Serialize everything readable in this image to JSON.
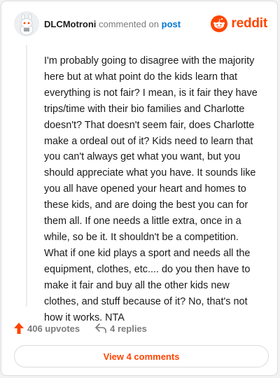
{
  "header": {
    "username": "DLCMotroni",
    "commented_on": "commented on",
    "post_link": "post",
    "brand": "reddit"
  },
  "comment": {
    "body": "I'm probably going to disagree with the majority here but at what point do the kids learn that everything is not fair? I mean, is it fair they have trips/time with their bio families and Charlotte doesn't? That doesn't seem fair, does Charlotte make a ordeal out of it? Kids need to learn that you can't always get what you want, but you should appreciate what you have. It sounds like you all have opened your heart and homes to these kids, and are doing the best you can for them all. If one needs a little extra, once in a while, so be it. It shouldn't be a competition. What if one kid plays a sport and needs all the equipment, clothes, etc.... do you then have to make it fair and buy all the other kids new clothes, and stuff because of it? No, that's not how it works. NTA"
  },
  "actions": {
    "upvotes": "406 upvotes",
    "replies": "4 replies"
  },
  "footer": {
    "view_comments": "View 4 comments"
  },
  "icons": {
    "upvote": "upvote-arrow-icon",
    "reply": "reply-arrow-icon",
    "brand": "reddit-snoo-icon",
    "avatar": "snoo-avatar-icon"
  },
  "colors": {
    "brand": "#ff4500",
    "link": "#0079d3",
    "text": "#1a1a1b",
    "muted": "#7c7c7c"
  }
}
